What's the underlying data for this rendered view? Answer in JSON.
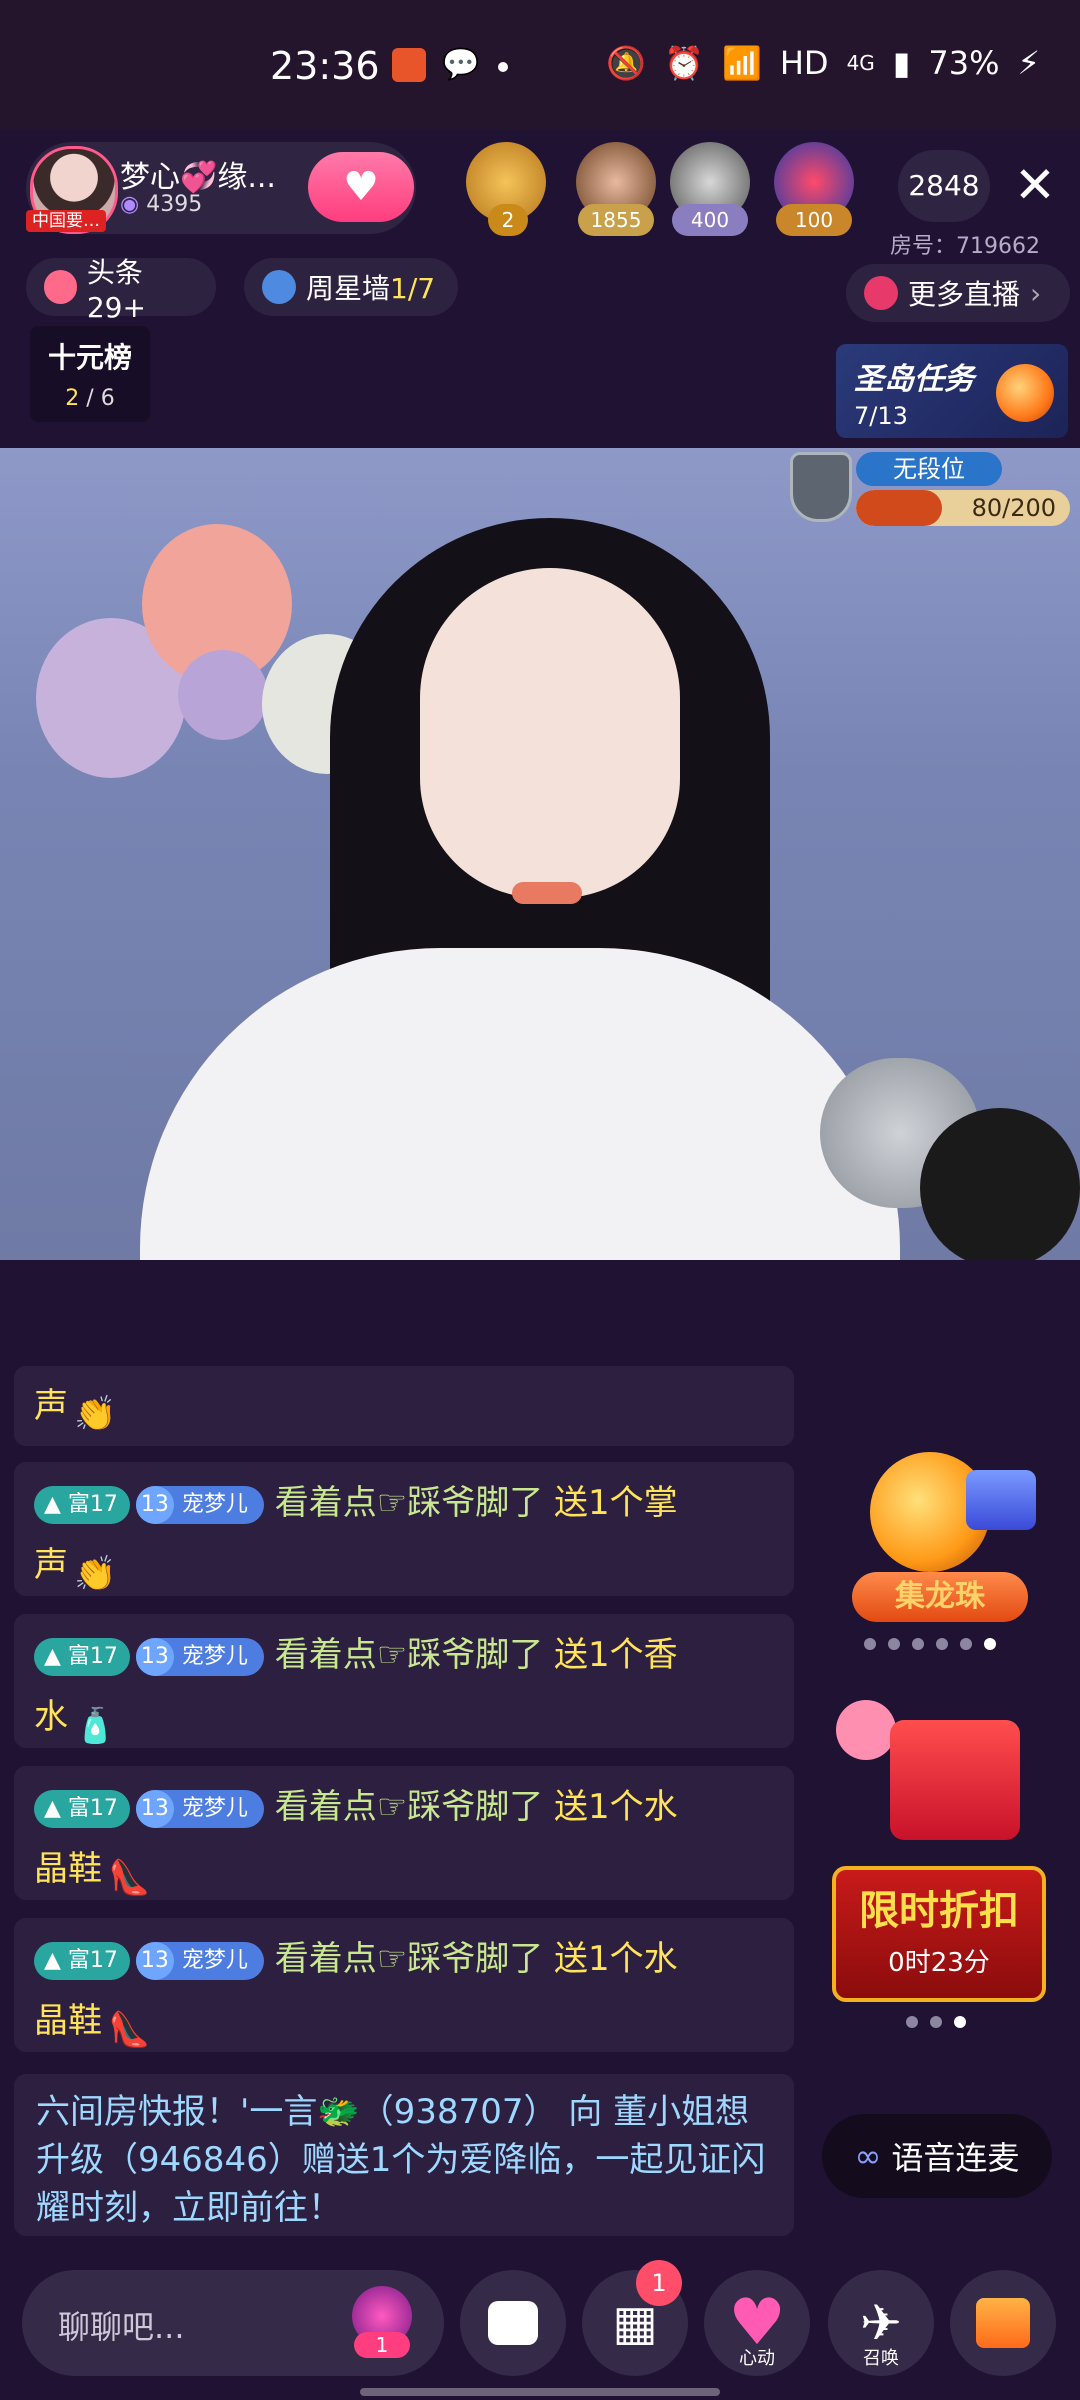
{
  "status_bar": {
    "time": "23:36",
    "network": "HD",
    "signal": "4G",
    "battery": "73%"
  },
  "host": {
    "name": "梦心💞缘...",
    "fans": "4395",
    "badge": "中国要…"
  },
  "viewers": [
    {
      "count": "2",
      "color": "#c98a1a"
    },
    {
      "count": "1855",
      "color": "#c9a14a"
    },
    {
      "count": "400",
      "color": "#8a7ec0"
    },
    {
      "count": "100",
      "color": "#c9862a"
    }
  ],
  "online_count": "2848",
  "room_id": "房号：719662",
  "chips": {
    "headline": "头条29+",
    "week_star_label": "周星墙",
    "week_star_value": "1/7",
    "more_live": "更多直播"
  },
  "rank": {
    "title": "十元榜",
    "current": "2",
    "total": "/ 6"
  },
  "task": {
    "title": "圣岛任务",
    "progress": "7/13"
  },
  "level": {
    "name": "无段位",
    "value": "80/200",
    "fraction": 0.4
  },
  "chat": {
    "partial_top": {
      "gift": "声"
    },
    "messages": [
      {
        "rich": "富17",
        "fan_level": "13",
        "fan_name": "宠梦儿",
        "user": "看着点☞踩爷脚了",
        "gift_a": "送1个掌",
        "gift_b": "声"
      },
      {
        "rich": "富17",
        "fan_level": "13",
        "fan_name": "宠梦儿",
        "user": "看着点☞踩爷脚了",
        "gift_a": "送1个香",
        "gift_b": "水"
      },
      {
        "rich": "富17",
        "fan_level": "13",
        "fan_name": "宠梦儿",
        "user": "看着点☞踩爷脚了",
        "gift_a": "送1个水",
        "gift_b": "晶鞋"
      },
      {
        "rich": "富17",
        "fan_level": "13",
        "fan_name": "宠梦儿",
        "user": "看着点☞踩爷脚了",
        "gift_a": "送1个水",
        "gift_b": "晶鞋"
      }
    ],
    "broadcast": "六间房快报！'一言🐲（938707） 向 董小姐想升级（946846）赠送1个为爱降临，一起见证闪耀时刻，立即前往！"
  },
  "widgets": {
    "dragon_label": "集龙珠",
    "sale_title": "限时折扣",
    "sale_time": "0时23分",
    "voice_link": "语音连麦"
  },
  "bottom": {
    "input_placeholder": "聊聊吧...",
    "crown_count": "1",
    "apps_badge": "1",
    "heart_label": "心动",
    "summon_label": "召唤"
  }
}
